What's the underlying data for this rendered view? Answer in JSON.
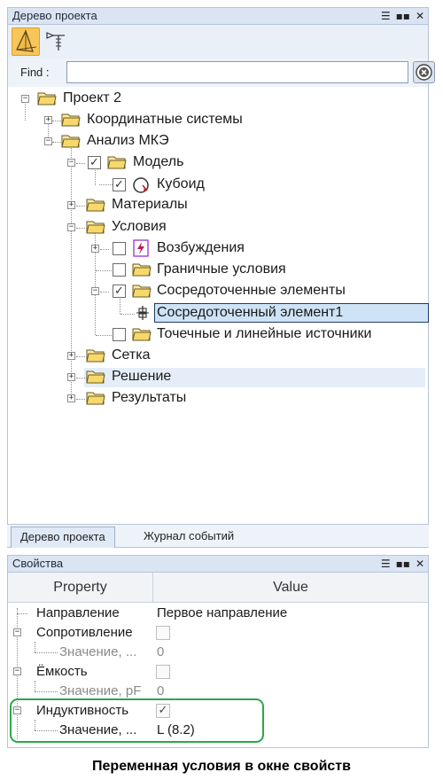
{
  "project_tree_panel": {
    "title": "Дерево проекта",
    "find_label": "Find :",
    "find_value": "",
    "nodes": [
      {
        "label": "Проект 2"
      },
      {
        "label": "Координатные системы"
      },
      {
        "label": "Анализ МКЭ"
      },
      {
        "label": "Модель",
        "checked": true
      },
      {
        "label": "Кубоид",
        "checked": true
      },
      {
        "label": "Материалы"
      },
      {
        "label": "Условия"
      },
      {
        "label": "Возбуждения",
        "checked": false
      },
      {
        "label": "Граничные условия",
        "checked": false
      },
      {
        "label": "Сосредоточенные элементы",
        "checked": true
      },
      {
        "label": "Сосредоточенный элемент1",
        "selected": true
      },
      {
        "label": "Точечные и линейные источники",
        "checked": false
      },
      {
        "label": "Сетка"
      },
      {
        "label": "Решение"
      },
      {
        "label": "Результаты"
      }
    ],
    "tabs": [
      {
        "label": "Дерево проекта",
        "active": true
      },
      {
        "label": "Журнал событий",
        "active": false
      }
    ]
  },
  "properties_panel": {
    "title": "Свойства",
    "header": {
      "property": "Property",
      "value": "Value"
    },
    "rows": [
      {
        "name": "Направление",
        "value": "Первое направление"
      },
      {
        "name": "Сопротивление",
        "checked": false
      },
      {
        "name": "Значение, ...",
        "value": "0"
      },
      {
        "name": "Ёмкость",
        "checked": false
      },
      {
        "name": "Значение, pF",
        "value": "0"
      },
      {
        "name": "Индуктивность",
        "checked": true
      },
      {
        "name": "Значение, ...",
        "value": "L (8.2)"
      }
    ]
  },
  "caption": "Переменная условия в окне свойств",
  "colors": {
    "titlebar": "#dbe4f2",
    "selection_border": "#1f3b66",
    "highlight_frame": "#2aa84a",
    "active_tool": "#f7c55a"
  },
  "icons": [
    "dock-menu-icon",
    "pin-icon",
    "close-icon",
    "model-view-icon",
    "constraint-tool-icon",
    "clear-search-icon",
    "folder-icon",
    "cuboid-icon",
    "excitation-icon",
    "lumped-element-icon"
  ]
}
